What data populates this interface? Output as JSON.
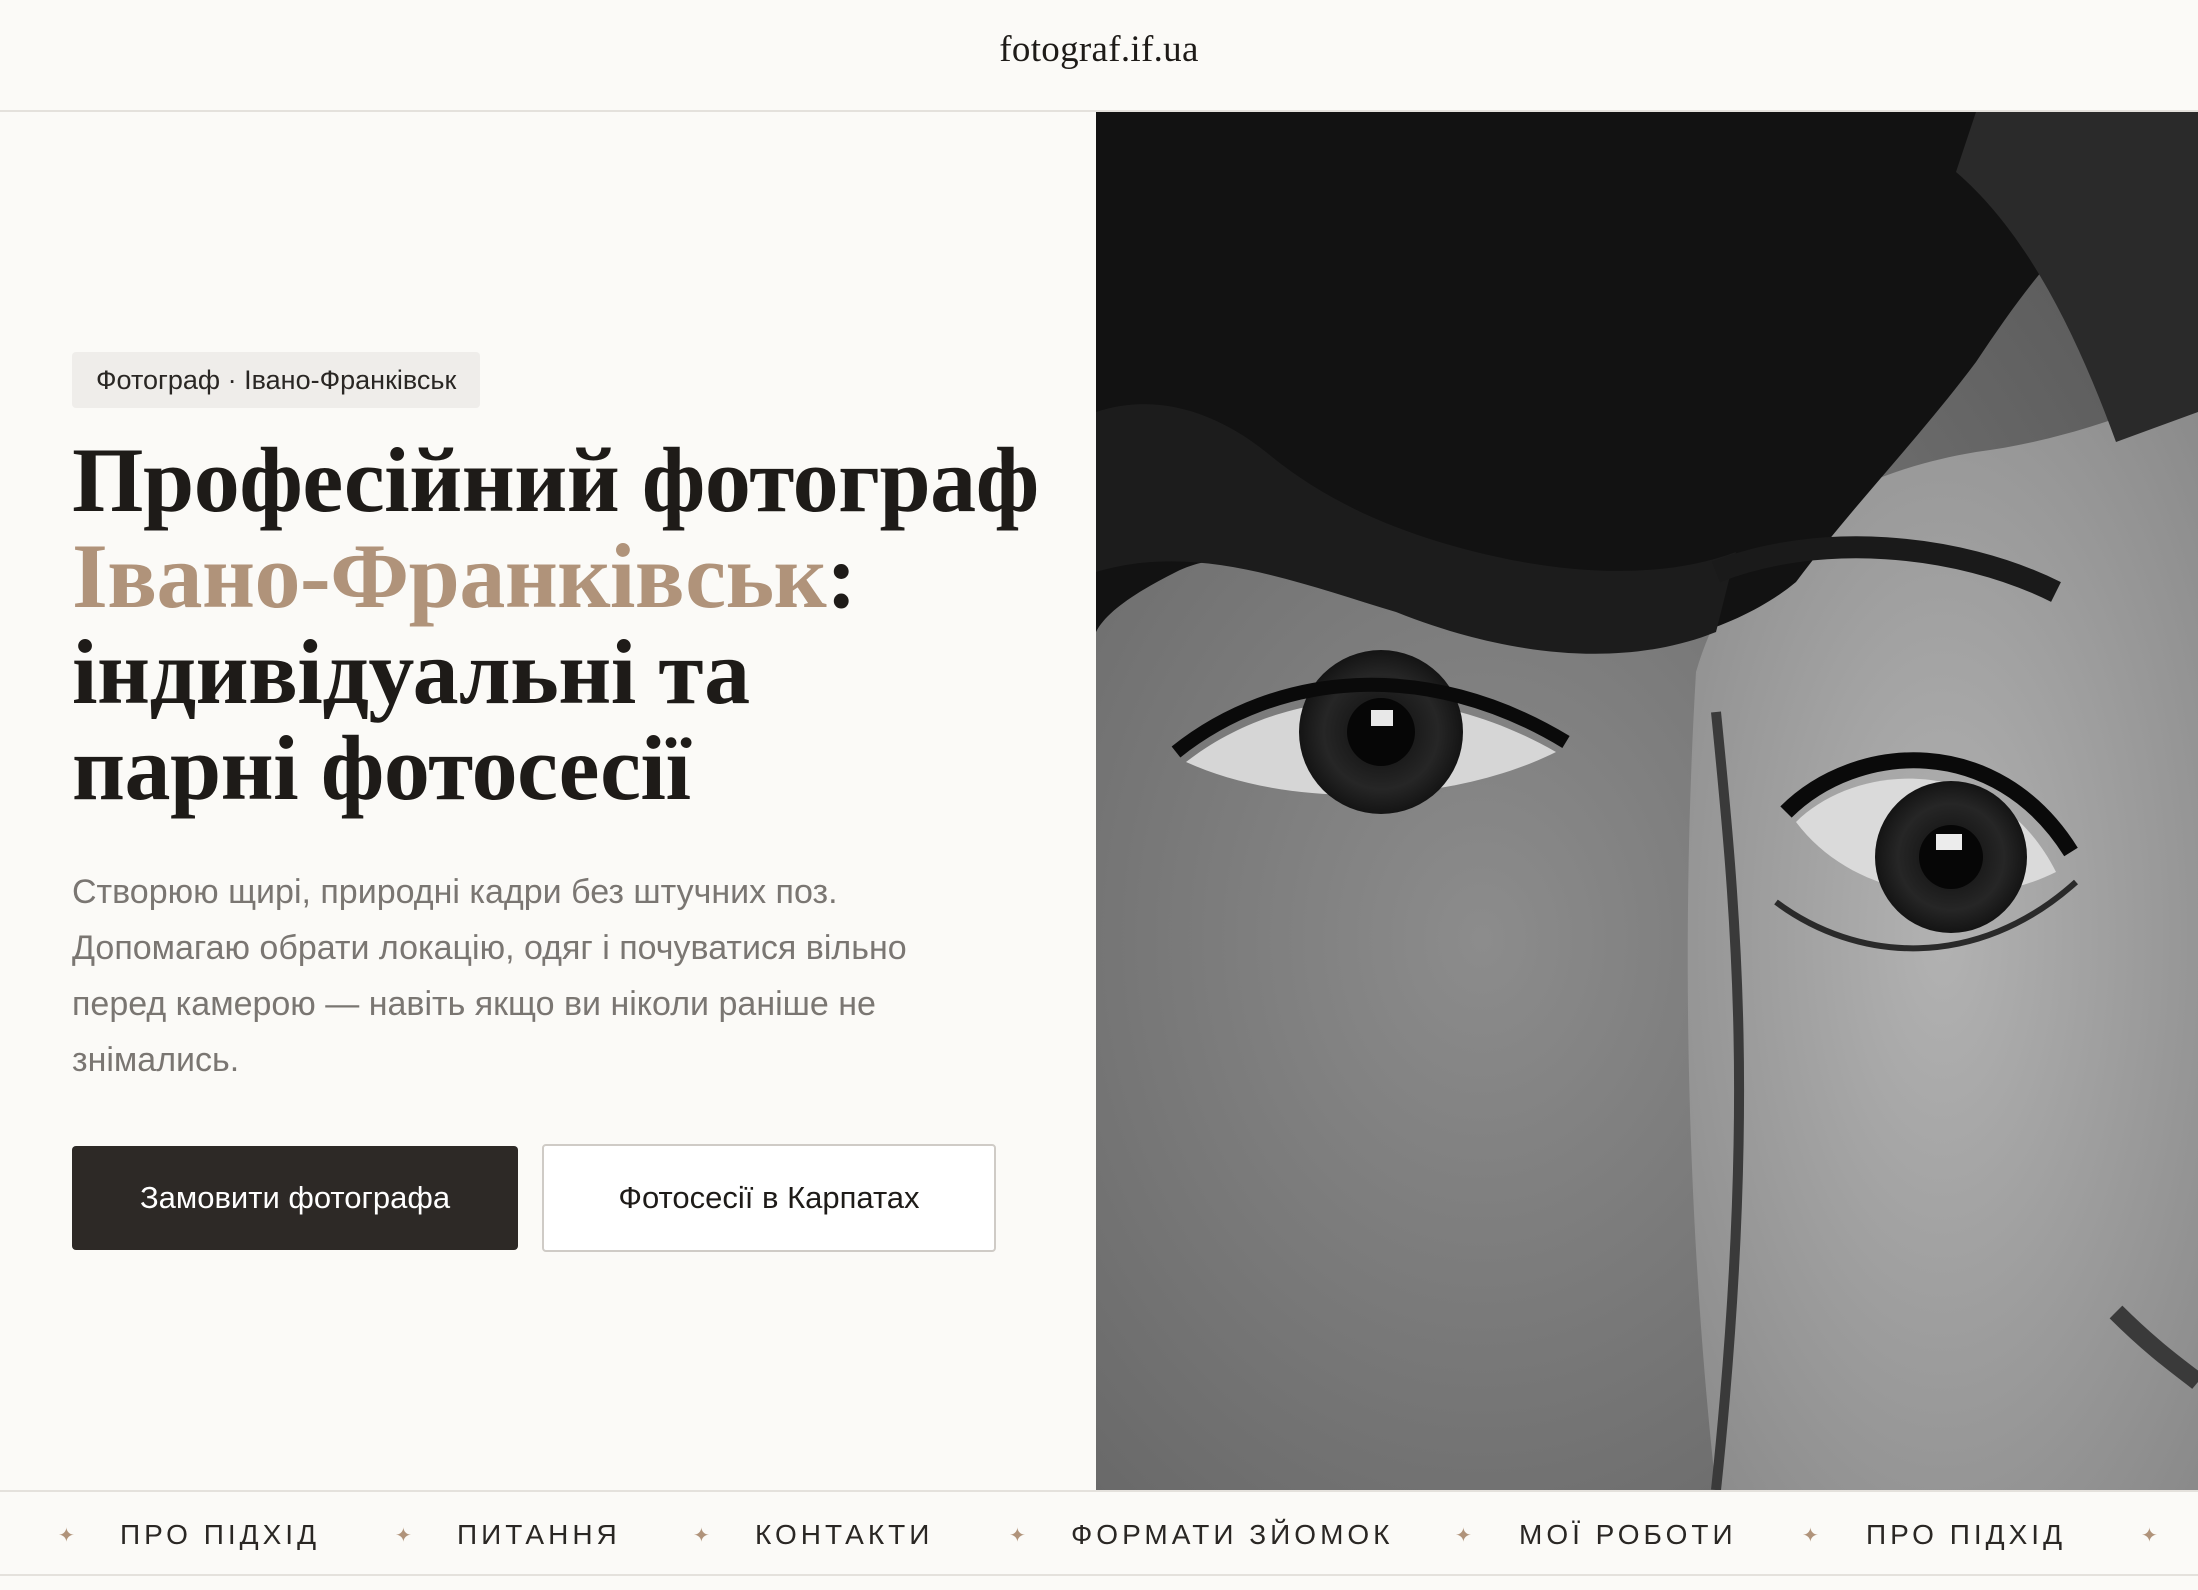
{
  "header": {
    "logo": "fotograf.if.ua"
  },
  "hero": {
    "tag": "Фотограф · Івано-Франківськ",
    "title_line1": "Професійний фотограф",
    "title_accent": "Івано-Франківськ",
    "title_colon": ":",
    "title_line3": "індивідуальні та",
    "title_line4": "парні фотосесії",
    "lead": "Створюю щирі, природні кадри без штучних поз. Допомагаю обрати локацію, одяг і почуватися вільно перед камерою — навіть якщо ви ніколи раніше не знімались.",
    "primary_button": "Замовити фотографа",
    "secondary_button": "Фотосесії в Карпатах"
  },
  "marquee": {
    "items": [
      "ПРО ПІДХІД",
      "ПИТАННЯ",
      "КОНТАКТИ",
      "ФОРМАТИ ЗЙОМОК",
      "МОЇ РОБОТИ",
      "ПРО ПІДХІД"
    ],
    "separator": "✦"
  },
  "colors": {
    "accent": "#b0937a",
    "background": "#fbfaf7",
    "primary_button": "#2d2926"
  }
}
